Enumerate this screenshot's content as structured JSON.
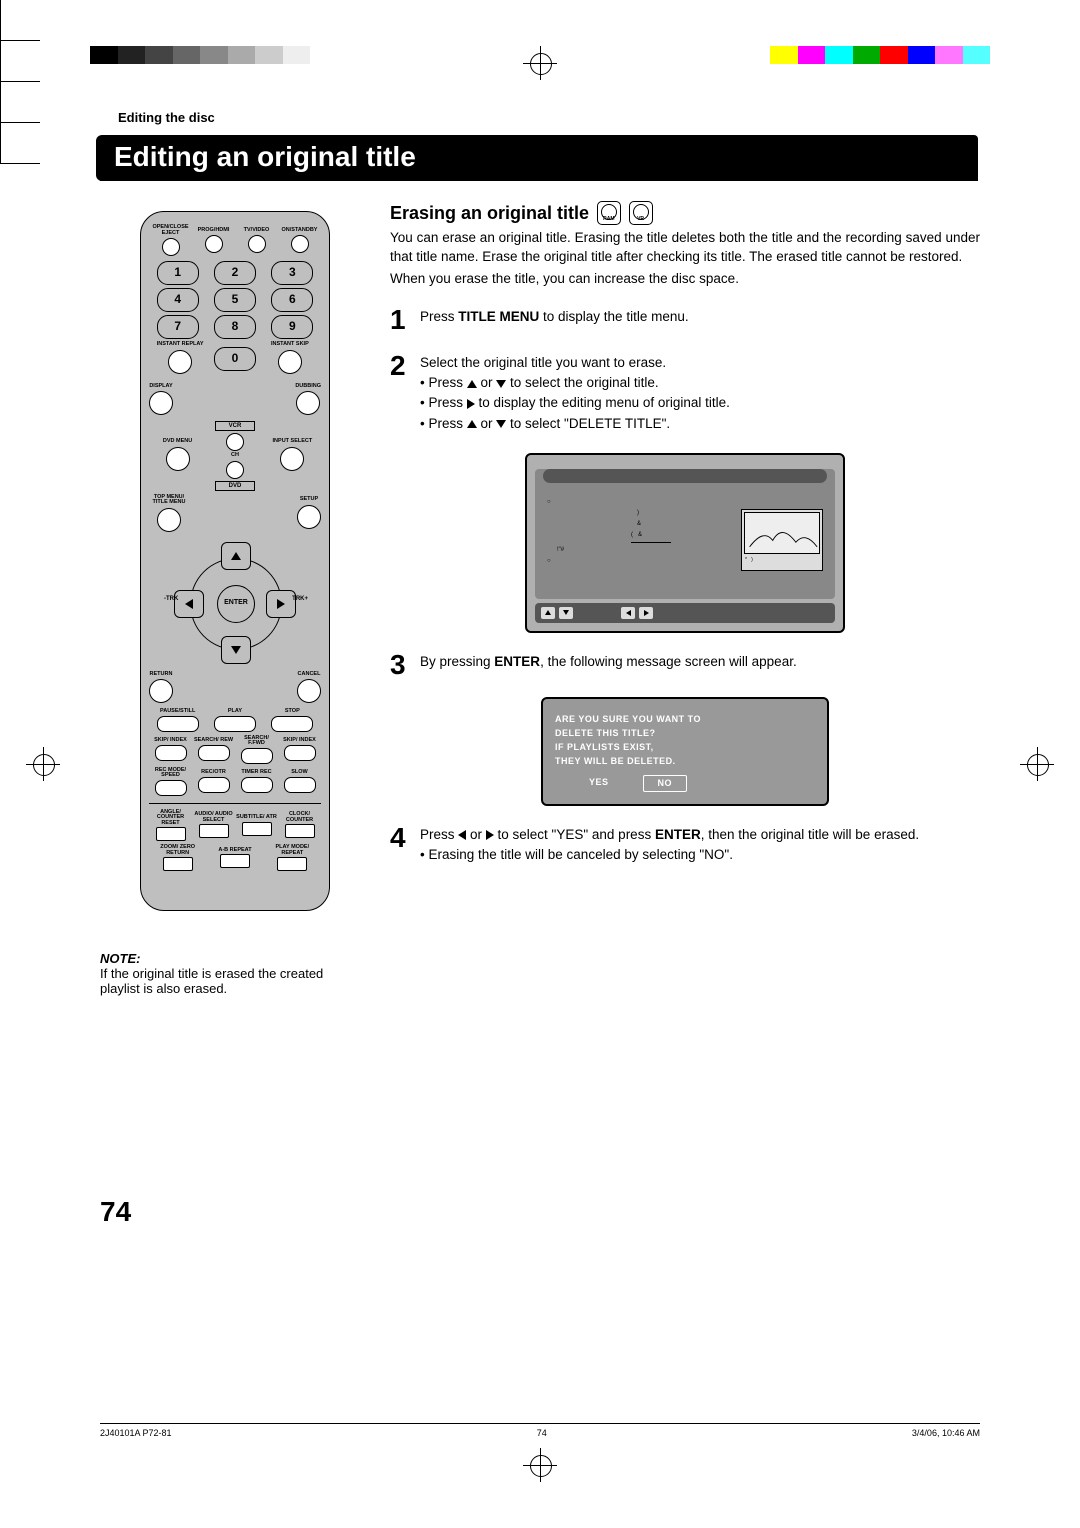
{
  "breadcrumb": "Editing the disc",
  "page_title": "Editing an original title",
  "section_title": "Erasing an original title",
  "disc_labels": [
    "RAM",
    "VR"
  ],
  "intro": [
    "You can erase an original title. Erasing the title deletes both the title and the recording saved under that title name. Erase the original title after checking its title. The erased title cannot be restored.",
    "When you erase the title, you can increase the disc space."
  ],
  "steps": {
    "1": {
      "text": "Press TITLE MENU to display the title menu.",
      "bold": "TITLE MENU"
    },
    "2": {
      "lead": "Select the original title you want to erase.",
      "bullets": [
        "Press ▲ or ▼ to select the original title.",
        "Press ▶ to display the editing menu of original title.",
        "Press ▲ or ▼ to select \"DELETE TITLE\"."
      ]
    },
    "3": {
      "text": "By pressing ENTER, the following message screen will appear.",
      "bold": "ENTER"
    },
    "4": {
      "text": "Press ◀ or ▶ to select \"YES\" and press ENTER, then the original title will be erased.",
      "bullet": "Erasing the title will be canceled by selecting \"NO\"."
    }
  },
  "dialog": {
    "lines": [
      "ARE YOU SURE YOU WANT TO",
      "DELETE THIS TITLE?",
      "IF PLAYLISTS EXIST,",
      "THEY WILL BE DELETED."
    ],
    "yes": "YES",
    "no": "NO"
  },
  "note_title": "NOTE:",
  "note_body": "If the original title is erased the created playlist is also erased.",
  "page_number": "74",
  "footer": {
    "left": "2J40101A P72-81",
    "center": "74",
    "right": "3/4/06, 10:46 AM"
  },
  "remote": {
    "top_labels": [
      "OPEN/CLOSE EJECT",
      "PROG/HDMI",
      "TV/VIDEO",
      "ON/STANDBY"
    ],
    "numbers": [
      "1",
      "2",
      "3",
      "4",
      "5",
      "6",
      "7",
      "8",
      "9",
      "0"
    ],
    "instant_replay": "INSTANT REPLAY",
    "instant_skip": "INSTANT SKIP",
    "display": "DISPLAY",
    "dubbing": "DUBBING",
    "vcr": "VCR",
    "dvd_menu": "DVD MENU",
    "ch": "CH",
    "input_select": "INPUT SELECT",
    "dvd": "DVD",
    "top_menu": "TOP MENU/ TITLE MENU",
    "setup": "SETUP",
    "trk_minus": "-TRK",
    "trk_plus": "TRK+",
    "enter": "ENTER",
    "return": "RETURN",
    "cancel": "CANCEL",
    "pause": "PAUSE/STILL",
    "play": "PLAY",
    "stop": "STOP",
    "transport": [
      "SKIP/ INDEX",
      "SEARCH/ REW",
      "SEARCH/ F.FWD",
      "SKIP/ INDEX"
    ],
    "rec_row": [
      "REC MODE/ SPEED",
      "REC/OTR",
      "TIMER REC",
      "SLOW"
    ],
    "bottom_row1": [
      "ANGLE/ COUNTER RESET",
      "AUDIO/ AUDIO SELECT",
      "SUBTITLE/ ATR",
      "CLOCK/ COUNTER"
    ],
    "bottom_row2": [
      "ZOOM/ ZERO RETURN",
      "A-B REPEAT",
      "PLAY MODE/ REPEAT"
    ]
  }
}
